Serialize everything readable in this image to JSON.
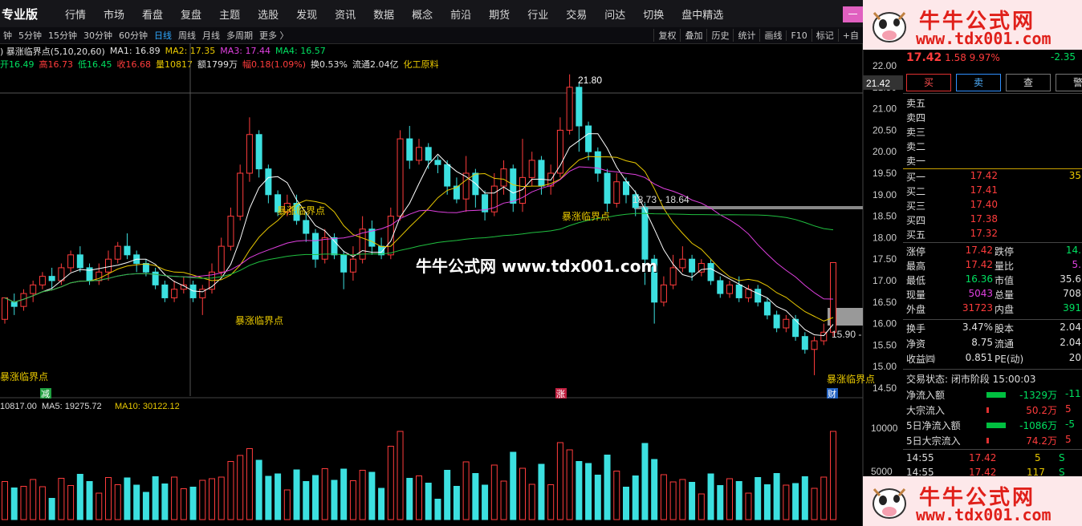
{
  "topbar": {
    "brand": "专业版",
    "menu": [
      "行情",
      "市场",
      "看盘",
      "复盘",
      "主题",
      "选股",
      "发现",
      "资讯",
      "数据",
      "概念",
      "前沿",
      "期货",
      "行业",
      "交易",
      "问达",
      "切换",
      "盘中精选"
    ],
    "right_btn": "一"
  },
  "periodbar": {
    "items": [
      "钟",
      "5分钟",
      "15分钟",
      "30分钟",
      "60分钟",
      "日线",
      "周线",
      "月线",
      "多周期",
      "更多 〉"
    ],
    "active_index": 5,
    "tools": [
      "复权",
      "叠加",
      "历史",
      "统计",
      "画线",
      "F10",
      "标记",
      "+自"
    ]
  },
  "indicator_line": {
    "name": ") 暴涨临界点(5,10,20,60)",
    "ma1": "MA1: 16.89",
    "ma2": "MA2: 17.35",
    "ma3": "MA3: 17.44",
    "ma4": "MA4: 16.57"
  },
  "quote_line": {
    "open": "开16.49",
    "high": "高16.73",
    "low": "低16.45",
    "close": "收16.68",
    "volume": "量10817",
    "amount": "额1799万",
    "range": "幅0.18(1.09%)",
    "turnover": "换0.53%",
    "float": "流通2.04亿",
    "industry": "化工原料"
  },
  "chart_labels": {
    "peak": "21.80",
    "range_label": "18.73 - 18.64",
    "last": "15.90 -",
    "signal": "暴涨临界点",
    "marker_jian": "减",
    "marker_zhang": "涨",
    "marker_cai": "财",
    "current_price_tag": "21.42"
  },
  "price_axis": [
    "22.00",
    "21.50",
    "21.00",
    "20.50",
    "20.00",
    "19.50",
    "19.00",
    "18.50",
    "18.00",
    "17.50",
    "17.00",
    "16.50",
    "16.00",
    "15.50",
    "15.00",
    "14.50"
  ],
  "volume_line": {
    "vol": "10817.00",
    "ma5": "MA5: 19275.72",
    "ma10": "MA10: 30122.12"
  },
  "volume_axis": [
    "10000",
    "5000"
  ],
  "center_watermark": "牛牛公式网 www.tdx001.com",
  "watermark": {
    "title": "牛牛公式网",
    "url": "www.tdx001.com"
  },
  "right_panel": {
    "price": "17.42",
    "change": "1.58",
    "pct": "9.97%",
    "change2": "-2.35",
    "buttons": [
      "买",
      "卖",
      "查",
      "警"
    ],
    "asks": [
      "卖五",
      "卖四",
      "卖三",
      "卖二",
      "卖一"
    ],
    "bids": [
      {
        "label": "买一",
        "price": "17.42",
        "vol": "35"
      },
      {
        "label": "买二",
        "price": "17.41",
        "vol": ""
      },
      {
        "label": "买三",
        "price": "17.40",
        "vol": ""
      },
      {
        "label": "买四",
        "price": "17.38",
        "vol": ""
      },
      {
        "label": "买五",
        "price": "17.32",
        "vol": ""
      }
    ],
    "stats": [
      {
        "l1": "涨停",
        "v1": "17.42",
        "l2": "跌停",
        "v2": "14."
      },
      {
        "l1": "最高",
        "v1": "17.42",
        "l2": "量比",
        "v2": "5."
      },
      {
        "l1": "最低",
        "v1": "16.36",
        "l2": "市值",
        "v2": "35.6"
      },
      {
        "l1": "现量",
        "v1": "5043",
        "l2": "总量",
        "v2": "708"
      },
      {
        "l1": "外盘",
        "v1": "31723",
        "l2": "内盘",
        "v2": "391"
      }
    ],
    "stats2": [
      {
        "l1": "换手",
        "v1": "3.47%",
        "l2": "股本",
        "v2": "2.04"
      },
      {
        "l1": "净资",
        "v1": "8.75",
        "l2": "流通",
        "v2": "2.04"
      },
      {
        "l1": "收益㈣",
        "v1": "0.851",
        "l2": "PE(动)",
        "v2": "20"
      }
    ],
    "status": "交易状态: 闭市阶段 15:00:03",
    "flows": [
      {
        "l": "净流入额",
        "v": "-1329万",
        "v2": "-11"
      },
      {
        "l": "大宗流入",
        "v": "50.2万",
        "v2": "5"
      },
      {
        "l": "5日净流入额",
        "v": "-1086万",
        "v2": "-5"
      },
      {
        "l": "5日大宗流入",
        "v": "74.2万",
        "v2": "5"
      }
    ],
    "tick": {
      "time": "14:55",
      "price": "17.42",
      "vol": "5",
      "flag": "S"
    },
    "tick2": {
      "time": "14:55",
      "price": "17.42",
      "vol": "117",
      "flag": "S"
    }
  },
  "chart_data": {
    "type": "candlestick",
    "ylim": [
      14.5,
      22.0
    ],
    "candles": [
      [
        16.1,
        16.6,
        16.0,
        16.5
      ],
      [
        16.5,
        16.4,
        16.2,
        16.7
      ],
      [
        16.4,
        16.7,
        16.3,
        16.8
      ],
      [
        16.7,
        16.9,
        16.5,
        17.0
      ],
      [
        16.9,
        17.1,
        16.8,
        17.2
      ],
      [
        17.1,
        17.0,
        16.8,
        17.3
      ],
      [
        17.0,
        17.3,
        16.9,
        17.4
      ],
      [
        17.3,
        17.6,
        17.2,
        17.7
      ],
      [
        17.6,
        17.3,
        17.2,
        17.8
      ],
      [
        17.3,
        17.0,
        16.9,
        17.4
      ],
      [
        17.0,
        17.2,
        16.9,
        17.4
      ],
      [
        17.2,
        17.5,
        17.0,
        17.7
      ],
      [
        17.5,
        17.8,
        17.4,
        17.9
      ],
      [
        17.8,
        17.6,
        17.5,
        18.1
      ],
      [
        17.6,
        17.4,
        17.2,
        17.7
      ],
      [
        17.4,
        17.2,
        17.1,
        17.5
      ],
      [
        17.2,
        16.9,
        16.8,
        17.3
      ],
      [
        16.9,
        16.6,
        16.5,
        17.0
      ],
      [
        16.6,
        16.8,
        16.5,
        17.0
      ],
      [
        16.8,
        16.9,
        16.7,
        17.1
      ],
      [
        16.9,
        16.6,
        16.5,
        17.0
      ],
      [
        16.6,
        16.8,
        16.2,
        16.9
      ],
      [
        16.8,
        17.2,
        16.7,
        17.4
      ],
      [
        17.2,
        17.8,
        17.1,
        18.0
      ],
      [
        17.8,
        18.5,
        17.7,
        18.7
      ],
      [
        18.5,
        19.5,
        18.4,
        19.7
      ],
      [
        19.5,
        20.4,
        19.3,
        20.8
      ],
      [
        20.4,
        19.6,
        19.4,
        20.5
      ],
      [
        19.6,
        19.0,
        18.8,
        19.7
      ],
      [
        19.0,
        18.6,
        18.5,
        19.1
      ],
      [
        18.6,
        18.8,
        18.5,
        19.0
      ],
      [
        18.8,
        18.4,
        18.3,
        19.0
      ],
      [
        18.4,
        18.1,
        17.9,
        18.6
      ],
      [
        18.1,
        17.5,
        17.3,
        18.2
      ],
      [
        17.5,
        18.0,
        17.4,
        18.2
      ],
      [
        18.0,
        17.6,
        17.5,
        18.1
      ],
      [
        17.6,
        17.2,
        16.8,
        17.7
      ],
      [
        17.2,
        17.5,
        17.0,
        17.8
      ],
      [
        17.5,
        18.2,
        17.4,
        18.5
      ],
      [
        18.2,
        17.8,
        17.6,
        18.4
      ],
      [
        17.8,
        17.6,
        17.5,
        18.0
      ],
      [
        17.6,
        18.5,
        17.5,
        18.7
      ],
      [
        18.5,
        20.3,
        18.4,
        20.5
      ],
      [
        20.3,
        19.8,
        19.6,
        20.6
      ],
      [
        19.8,
        20.1,
        19.7,
        20.3
      ],
      [
        20.1,
        19.8,
        19.6,
        20.2
      ],
      [
        19.8,
        19.7,
        19.5,
        19.9
      ],
      [
        19.7,
        19.2,
        19.0,
        19.8
      ],
      [
        19.2,
        18.9,
        18.8,
        19.4
      ],
      [
        18.9,
        19.5,
        18.6,
        19.9
      ],
      [
        19.5,
        19.0,
        18.7,
        19.6
      ],
      [
        19.0,
        18.6,
        18.4,
        19.1
      ],
      [
        18.6,
        19.2,
        18.5,
        19.5
      ],
      [
        19.2,
        19.6,
        19.0,
        19.8
      ],
      [
        19.6,
        18.8,
        18.6,
        19.7
      ],
      [
        18.8,
        19.4,
        18.6,
        20.3
      ],
      [
        19.4,
        19.8,
        19.2,
        20.0
      ],
      [
        19.8,
        19.2,
        19.0,
        19.9
      ],
      [
        19.2,
        19.5,
        19.0,
        19.7
      ],
      [
        19.5,
        20.5,
        19.4,
        20.8
      ],
      [
        20.5,
        21.5,
        20.4,
        21.8
      ],
      [
        21.5,
        20.6,
        20.0,
        21.6
      ],
      [
        20.6,
        20.0,
        19.8,
        20.7
      ],
      [
        20.0,
        19.5,
        19.3,
        20.1
      ],
      [
        19.5,
        18.8,
        18.6,
        19.6
      ],
      [
        18.8,
        19.3,
        18.7,
        19.5
      ],
      [
        19.3,
        19.0,
        18.8,
        19.4
      ],
      [
        19.0,
        18.7,
        18.5,
        19.1
      ],
      [
        18.7,
        17.5,
        16.9,
        18.8
      ],
      [
        17.5,
        16.5,
        16.0,
        17.6
      ],
      [
        16.5,
        16.9,
        16.4,
        17.1
      ],
      [
        16.9,
        17.3,
        16.8,
        17.6
      ],
      [
        17.3,
        17.5,
        17.2,
        17.8
      ],
      [
        17.5,
        17.2,
        17.0,
        17.6
      ],
      [
        17.2,
        17.4,
        17.1,
        17.5
      ],
      [
        17.4,
        17.0,
        16.9,
        17.5
      ],
      [
        17.0,
        16.7,
        16.6,
        17.1
      ],
      [
        16.7,
        16.9,
        16.6,
        17.0
      ],
      [
        16.9,
        16.6,
        16.5,
        17.1
      ],
      [
        16.6,
        16.8,
        16.5,
        16.9
      ],
      [
        16.8,
        16.5,
        16.4,
        16.9
      ],
      [
        16.5,
        16.2,
        16.1,
        16.6
      ],
      [
        16.2,
        15.9,
        15.8,
        16.3
      ],
      [
        15.9,
        16.1,
        15.8,
        16.2
      ],
      [
        16.1,
        15.7,
        15.6,
        16.2
      ],
      [
        15.7,
        15.4,
        15.3,
        15.8
      ],
      [
        15.4,
        15.6,
        14.8,
        15.7
      ],
      [
        15.6,
        15.8,
        15.5,
        16.0
      ],
      [
        15.8,
        17.42,
        15.7,
        17.42
      ]
    ],
    "annotations": [
      "21.80",
      "18.73 - 18.64",
      "15.90"
    ]
  }
}
